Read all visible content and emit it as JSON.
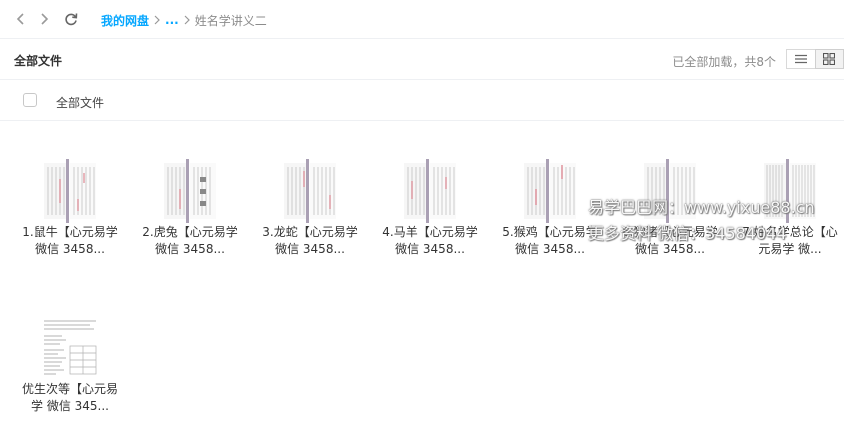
{
  "nav": {
    "back": "back-icon",
    "forward": "forward-icon",
    "refresh": "refresh-icon"
  },
  "breadcrumb": {
    "root": "我的网盘",
    "ellipsis": "...",
    "current": "姓名学讲义二"
  },
  "header": {
    "title": "全部文件",
    "status": "已全部加载，共8个"
  },
  "select_row": {
    "label": "全部文件"
  },
  "files": [
    {
      "name": "1.鼠牛【心元易学 微信 3458..."
    },
    {
      "name": "2.虎兔【心元易学 微信 3458..."
    },
    {
      "name": "3.龙蛇【心元易学 微信 3458..."
    },
    {
      "name": "4.马羊【心元易学 微信 3458..."
    },
    {
      "name": "5.猴鸡【心元易学 微信 3458..."
    },
    {
      "name": "6.狗猪【心元易学 微信 3458..."
    },
    {
      "name": "7.姓名学总论【心元易学 微..."
    },
    {
      "name": "优生次等【心元易学 微信 345..."
    }
  ],
  "watermark": {
    "line1": "易学巴巴网：www.yixue88.cn",
    "line2": "更多资料 微信：34584044"
  },
  "colors": {
    "accent": "#06a7ff",
    "muted": "#8c8c8c",
    "border": "#eef0f3"
  }
}
